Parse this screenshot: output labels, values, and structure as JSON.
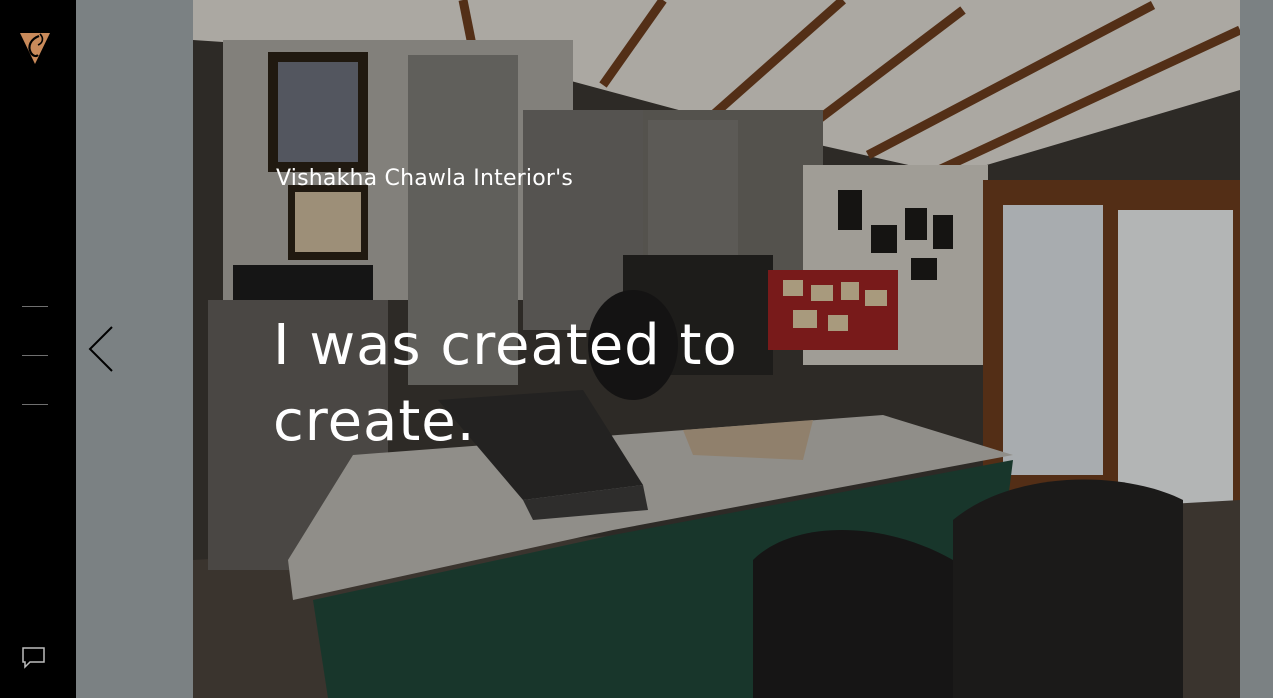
{
  "brand": {
    "logo_icon": "vc-logo-icon",
    "accent": "#c98a5a"
  },
  "hero": {
    "subtitle": "Vishakha Chawla Interior's",
    "headline": "I was created to create."
  },
  "nav": {
    "menu_icon": "menu-lines-icon",
    "prev_icon": "chevron-left-icon",
    "chat_icon": "chat-bubble-icon"
  }
}
